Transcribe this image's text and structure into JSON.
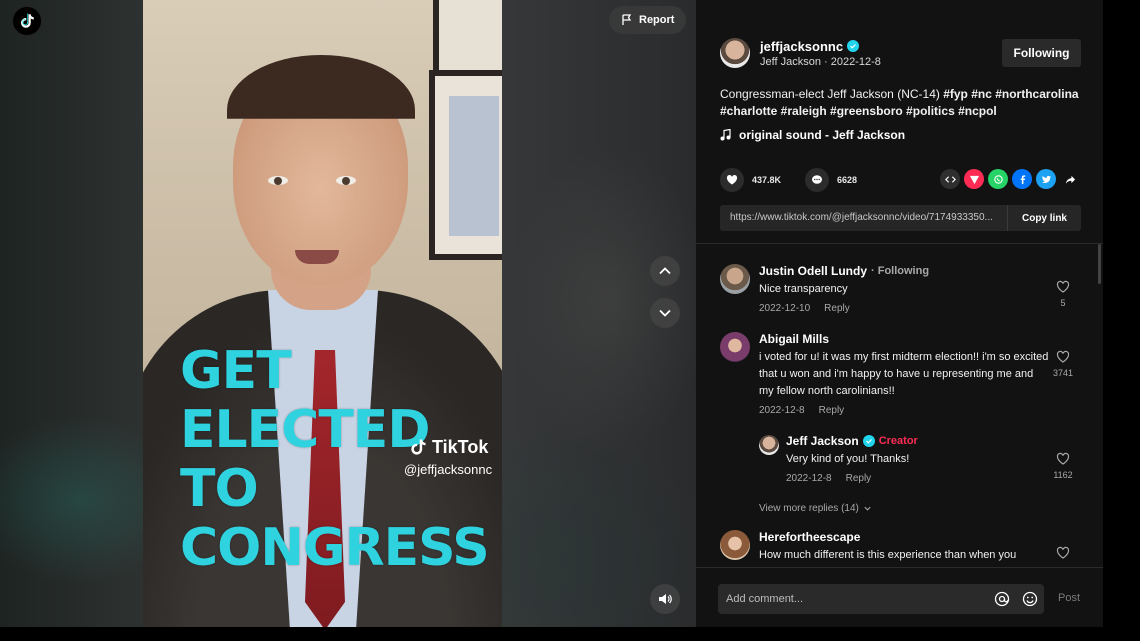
{
  "app": {
    "logo_icon": "tiktok-logo-icon"
  },
  "video": {
    "report_label": "Report",
    "overlay_lines": [
      "GET",
      "ELECTED",
      "TO",
      "CONGRESS"
    ],
    "overlay_color": "#2fd3e0",
    "watermark_brand": "TikTok",
    "watermark_handle": "@jeffjacksonnc"
  },
  "author": {
    "username": "jeffjacksonnc",
    "display_name": "Jeff Jackson",
    "date": "2022-12-8",
    "subline": "Jeff Jackson · 2022-12-8",
    "follow_label": "Following"
  },
  "post": {
    "description_text": "Congressman-elect Jeff Jackson (NC-14) ",
    "hashtags": "#fyp #nc #northcarolina #charlotte #raleigh #greensboro #politics #ncpol",
    "sound": "original sound - Jeff Jackson",
    "likes": "437.8K",
    "comments": "6628",
    "link_url": "https://www.tiktok.com/@jeffjacksonnc/video/7174933350...",
    "copy_link_label": "Copy link"
  },
  "share_icons": [
    "embed-icon",
    "send-to-friends-icon",
    "whatsapp-icon",
    "facebook-icon",
    "twitter-icon",
    "share-arrow-icon"
  ],
  "comments": [
    {
      "name": "Justin Odell Lundy",
      "tag": "· Following",
      "text": "Nice transparency",
      "date": "2022-12-10",
      "reply_label": "Reply",
      "likes": "5"
    },
    {
      "name": "Abigail Mills",
      "text": "i voted for u! it was my first midterm election!! i'm so excited that u won and i'm happy to have u representing me and my fellow north carolinians!!",
      "date": "2022-12-8",
      "reply_label": "Reply",
      "likes": "3741"
    },
    {
      "name": "Jeff Jackson",
      "tag": "Creator",
      "text": "Very kind of you! Thanks!",
      "date": "2022-12-8",
      "reply_label": "Reply",
      "likes": "1162"
    },
    {
      "name": "Herefortheescape",
      "text": "How much different is this experience than when you",
      "likes": ""
    }
  ],
  "view_more_replies": "View more replies (14)",
  "comment_input": {
    "placeholder": "Add comment...",
    "post_label": "Post"
  },
  "colors": {
    "accent": "#fe2c55",
    "verified": "#20d5ec",
    "panel_bg": "#121212"
  }
}
